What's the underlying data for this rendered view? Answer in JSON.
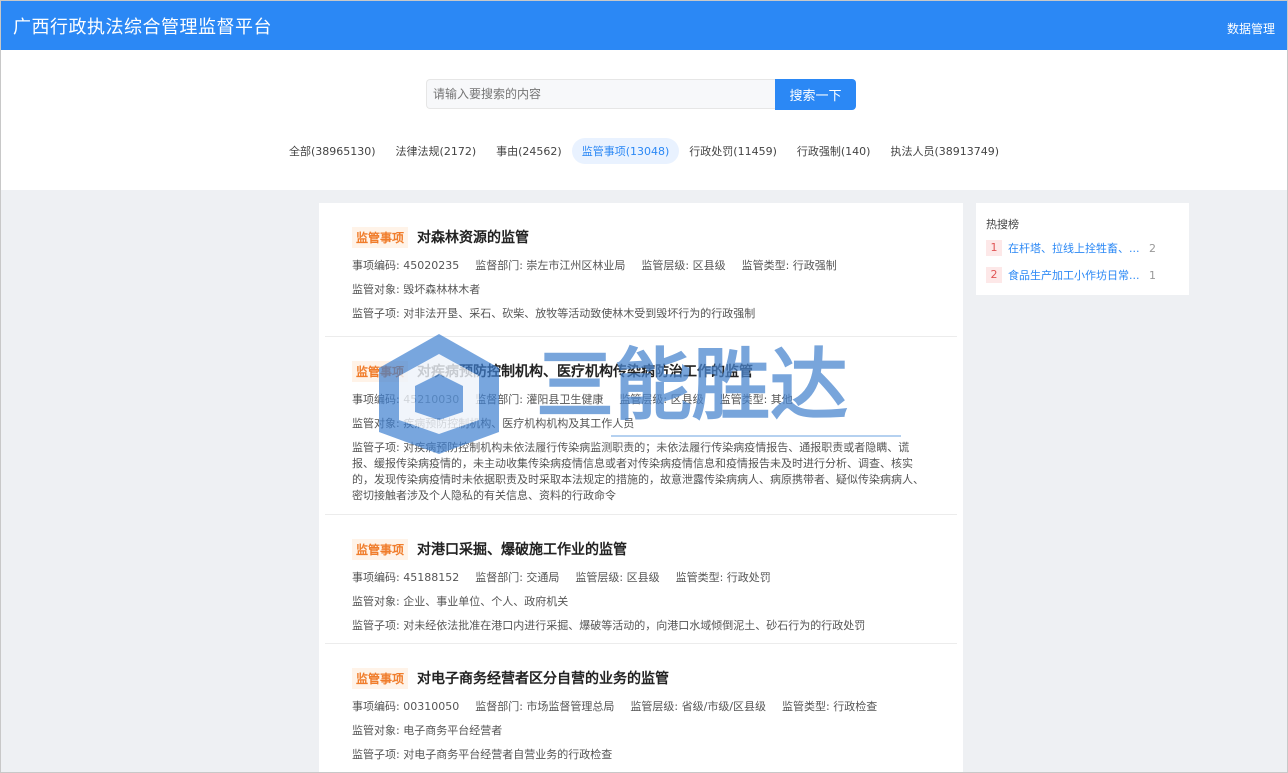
{
  "header": {
    "app_title": "广西行政执法综合管理监督平台",
    "data_mgmt": "数据管理"
  },
  "search": {
    "placeholder": "请输入要搜索的内容",
    "button": "搜索一下"
  },
  "tabs": [
    {
      "label": "全部(38965130)"
    },
    {
      "label": "法律法规(2172)"
    },
    {
      "label": "事由(24562)"
    },
    {
      "label": "监管事项(13048)",
      "active": true
    },
    {
      "label": "行政处罚(11459)"
    },
    {
      "label": "行政强制(140)"
    },
    {
      "label": "执法人员(38913749)"
    }
  ],
  "results": [
    {
      "tag": "监管事项",
      "title": "对森林资源的监管",
      "code": "事项编码: 45020235",
      "dept": "监督部门: 崇左市江州区林业局",
      "level": "监管层级: 区县级",
      "type": "监管类型: 行政强制",
      "object": "监管对象: 毁坏森林林木者",
      "sub": "监管子项: 对非法开垦、采石、砍柴、放牧等活动致使林木受到毁坏行为的行政强制"
    },
    {
      "tag": "监管事项",
      "title": "对疾病预防控制机构、医疗机构传染病防治工作的监管",
      "code": "事项编码: 45210030",
      "dept": "监督部门: 灌阳县卫生健康",
      "level": "监管层级: 区县级",
      "type": "监管类型: 其他",
      "object": "监管对象: 疾病预防控制机构、医疗机构机构及其工作人员",
      "sub": "监管子项: 对疾病预防控制机构未依法履行传染病监测职责的；未依法履行传染病疫情报告、通报职责或者隐瞒、谎报、缓报传染病疫情的，未主动收集传染病疫情信息或者对传染病疫情信息和疫情报告未及时进行分析、调查、核实的，发现传染病疫情时未依据职责及时采取本法规定的措施的，故意泄露传染病病人、病原携带者、疑似传染病病人、密切接触者涉及个人隐私的有关信息、资料的行政命令"
    },
    {
      "tag": "监管事项",
      "title": "对港口采掘、爆破施工作业的监管",
      "code": "事项编码: 45188152",
      "dept": "监督部门: 交通局",
      "level": "监管层级: 区县级",
      "type": "监管类型: 行政处罚",
      "object": "监管对象: 企业、事业单位、个人、政府机关",
      "sub": "监管子项: 对未经依法批准在港口内进行采掘、爆破等活动的，向港口水域倾倒泥土、砂石行为的行政处罚"
    },
    {
      "tag": "监管事项",
      "title": "对电子商务经营者区分自营的业务的监管",
      "code": "事项编码: 00310050",
      "dept": "监督部门: 市场监督管理总局",
      "level": "监管层级: 省级/市级/区县级",
      "type": "监管类型: 行政检查",
      "object": "监管对象: 电子商务平台经营者",
      "sub": "监管子项: 对电子商务平台经营者自营业务的行政检查"
    }
  ],
  "hot": {
    "title": "热搜榜",
    "items": [
      {
        "rank": "1",
        "text": "在杆塔、拉线上拴牲畜、...",
        "count": "2"
      },
      {
        "rank": "2",
        "text": "食品生产加工小作坊日常...",
        "count": "1"
      }
    ]
  },
  "watermark": {
    "text": "三能胜达"
  },
  "colors": {
    "primary": "#2b88f5",
    "tag": "#f07c2a",
    "hot_rank": "#e05555"
  }
}
